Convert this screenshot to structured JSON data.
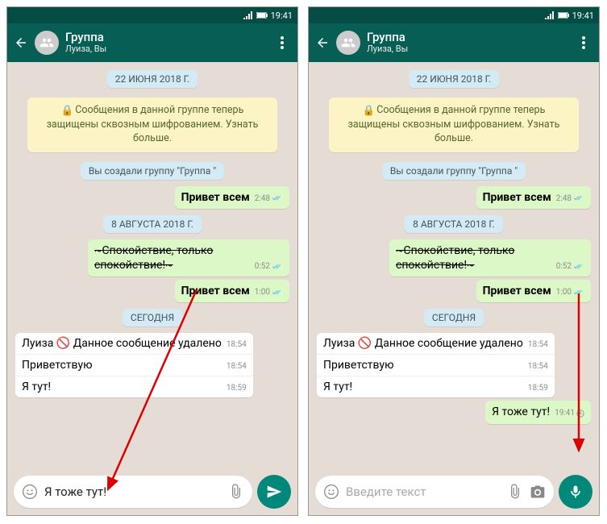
{
  "status": {
    "time": "19:41"
  },
  "header": {
    "title": "Группа",
    "subtitle": "Луиза, Вы"
  },
  "dates": {
    "d1": "22 ИЮНЯ 2018 Г.",
    "d2": "8 АВГУСТА 2018 Г.",
    "d3": "СЕГОДНЯ"
  },
  "encryption": "Сообщения в данной группе теперь защищены сквозным шифрованием. Узнать больше.",
  "system_created": "Вы создали группу \"Группа \"",
  "msgs": {
    "m1": {
      "text": "Привет всем",
      "time": "2:48"
    },
    "m2": {
      "text": "~Спокойствие, только спокойствие!~",
      "time": "0:52"
    },
    "m3": {
      "text": "Привет всем",
      "time": "1:00"
    },
    "sender_luiza": "Луиза",
    "deleted": {
      "text": "Данное сообщение удалено",
      "time": "18:54"
    },
    "m4": {
      "text": "Приветствую",
      "time": "18:54"
    },
    "m5": {
      "text": "Я тут!",
      "time": "18:59"
    },
    "m6": {
      "text": "Я тоже тут!",
      "time": "19:41"
    }
  },
  "composer": {
    "left_value": "Я тоже тут!",
    "right_placeholder": "Введите текст"
  }
}
